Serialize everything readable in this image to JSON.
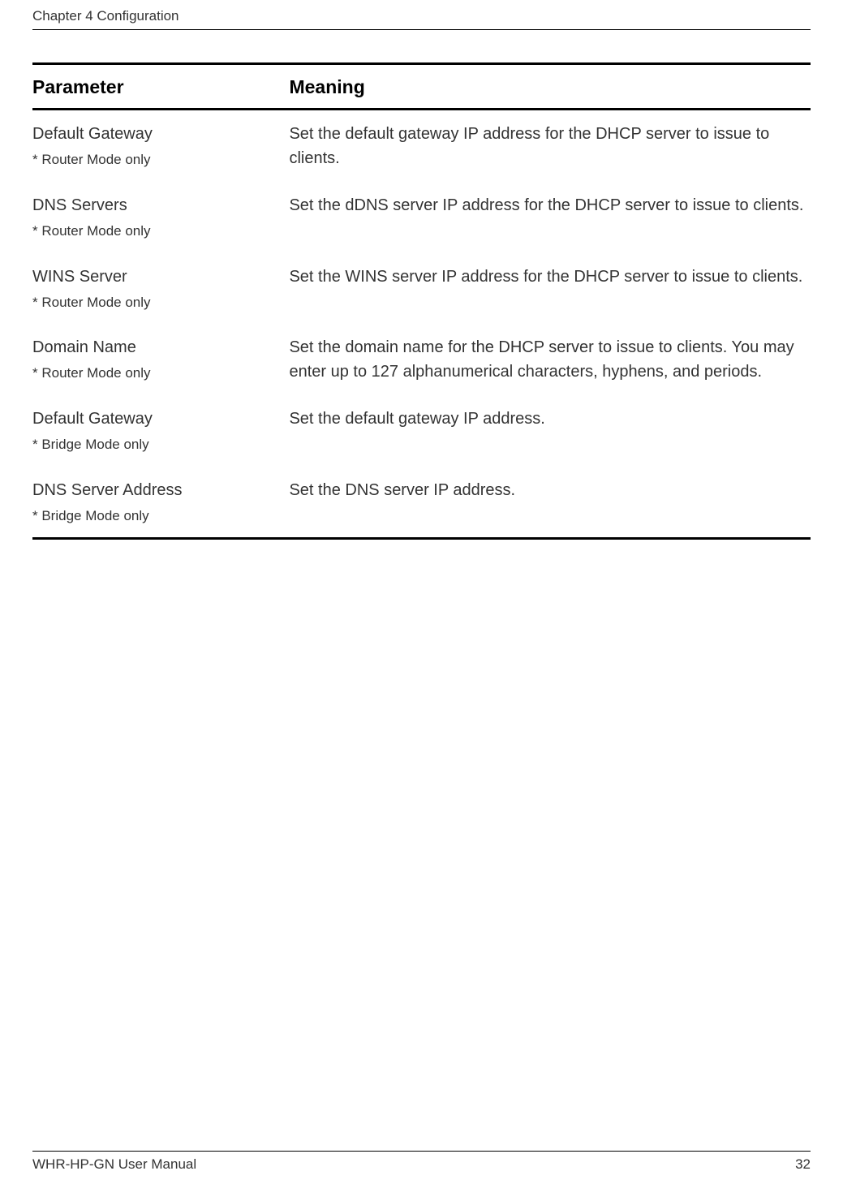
{
  "header": {
    "chapter": "Chapter 4  Configuration"
  },
  "table": {
    "headers": {
      "parameter": "Parameter",
      "meaning": "Meaning"
    },
    "rows": [
      {
        "name": "Default Gateway",
        "note": "* Router Mode only",
        "meaning": "Set the default gateway IP address for the DHCP server to issue to clients."
      },
      {
        "name": "DNS Servers",
        "note": "* Router Mode only",
        "meaning": "Set the dDNS server IP address for the DHCP server to issue to clients."
      },
      {
        "name": "WINS Server",
        "note": "* Router Mode only",
        "meaning": "Set the WINS server IP address for the DHCP server to issue to clients."
      },
      {
        "name": "Domain Name",
        "note": "* Router Mode only",
        "meaning": "Set the domain name for the DHCP server to issue to clients. You may enter up to 127 alphanumerical characters, hyphens, and periods."
      },
      {
        "name": "Default Gateway",
        "note": "* Bridge Mode only",
        "meaning": "Set the default gateway IP address."
      },
      {
        "name": "DNS Server Address",
        "note": "* Bridge Mode only",
        "meaning": "Set the DNS server IP address."
      }
    ]
  },
  "footer": {
    "left": "WHR-HP-GN User Manual",
    "right": "32"
  }
}
